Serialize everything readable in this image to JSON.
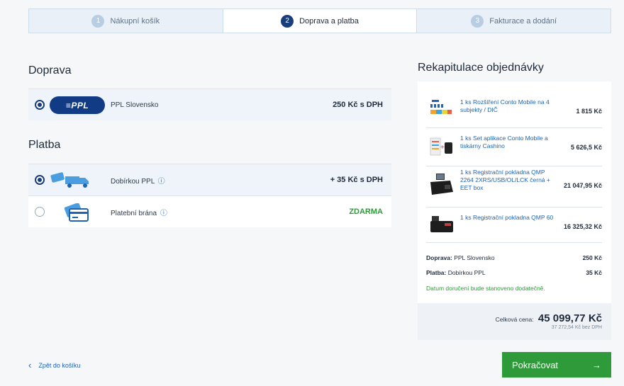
{
  "steps": [
    {
      "num": "1",
      "label": "Nákupní košík"
    },
    {
      "num": "2",
      "label": "Doprava a platba"
    },
    {
      "num": "3",
      "label": "Fakturace a dodání"
    }
  ],
  "shipping": {
    "title": "Doprava",
    "options": [
      {
        "logo_text": "≡PPL",
        "name": "PPL Slovensko",
        "price": "250 Kč s DPH",
        "selected": true
      }
    ]
  },
  "payment": {
    "title": "Platba",
    "info_glyph": "ⓘ",
    "options": [
      {
        "name": "Dobírkou PPL",
        "price": "+ 35 Kč s DPH",
        "selected": true,
        "icon": "truck-icon"
      },
      {
        "name": "Platební brána",
        "price": "ZDARMA",
        "selected": false,
        "icon": "card-icon"
      }
    ]
  },
  "summary": {
    "title": "Rekapitulace objednávky",
    "items": [
      {
        "desc": "1 ks Rozšíření Conto Mobile na 4 subjekty / DIČ",
        "price": "1 815 Kč"
      },
      {
        "desc": "1 ks Set aplikace Conto Mobile a tiskárny Cashino",
        "price": "5 626,5 Kč"
      },
      {
        "desc": "1 ks Registrační pokladna QMP 2264 2XRS/USB/OL/LCK černá + EET box",
        "price": "21 047,95 Kč"
      },
      {
        "desc": "1 ks Registrační pokladna QMP 60",
        "price": "16 325,32 Kč"
      }
    ],
    "shipping_label": "Doprava:",
    "shipping_value": "PPL Slovensko",
    "shipping_price": "250 Kč",
    "payment_label": "Platba:",
    "payment_value": "Dobírkou PPL",
    "payment_price": "35 Kč",
    "note": "Datum doručení bude stanoveno dodatečně.",
    "total_label": "Celková cena:",
    "total": "45 099,77 Kč",
    "total_no_vat": "37 272,54 Kč bez DPH"
  },
  "back_label": "Zpět do košíku",
  "continue_label": "Pokračovat",
  "continue_arrow": "→",
  "back_arrow": "‹",
  "colors": {
    "primary": "#1a3d7c",
    "link": "#1e63b4",
    "success": "#2e9a3a"
  }
}
